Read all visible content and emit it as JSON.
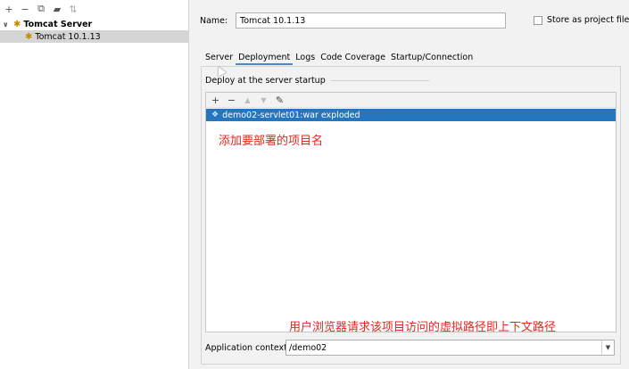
{
  "left_panel": {
    "toolbar": {
      "add_icon": "plus-icon",
      "remove_icon": "minus-icon",
      "copy_icon": "copy-icon",
      "folder_icon": "folder-icon",
      "sort_icon": "sort-icon"
    },
    "tree": {
      "root_label": "Tomcat Server",
      "child_label": "Tomcat 10.1.13"
    }
  },
  "config": {
    "name_label": "Name:",
    "name_value": "Tomcat 10.1.13",
    "store_label": "Store as project file",
    "tabs": [
      "Server",
      "Deployment",
      "Logs",
      "Code Coverage",
      "Startup/Connection"
    ],
    "active_tab": "Deployment",
    "deployment": {
      "section_title": "Deploy at the server startup",
      "items": [
        "demo02-servlet01:war exploded"
      ],
      "annotation_top": "添加要部署的项目名",
      "annotation_bottom": "用户浏览器请求该项目访问的虚拟路径即上下文路径"
    },
    "context": {
      "label": "Application context:",
      "value": "/demo02"
    }
  },
  "colors": {
    "selection": "#2675bf",
    "annotation": "#e8261f",
    "active_tab_underline": "#4a88c7"
  }
}
